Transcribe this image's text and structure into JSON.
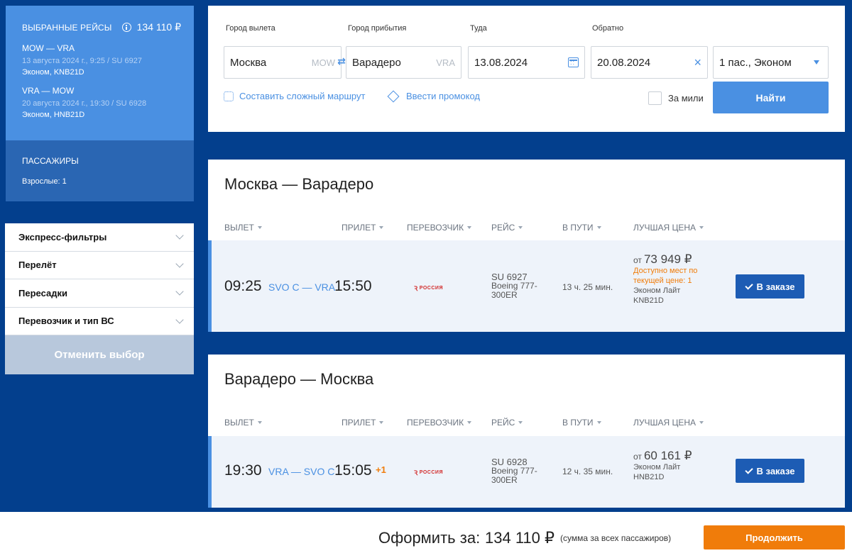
{
  "selected": {
    "title": "ВЫБРАННЫЕ РЕЙСЫ",
    "total": "134 110 ₽",
    "flights": [
      {
        "route": "MOW — VRA",
        "date": "13 августа 2024 г., 9:25 / SU 6927",
        "class": "Эконом, KNB21D"
      },
      {
        "route": "VRA — MOW",
        "date": "20 августа 2024 г., 19:30 / SU 6928",
        "class": "Эконом, HNB21D"
      }
    ]
  },
  "passengers": {
    "title": "ПАССАЖИРЫ",
    "adults": "Взрослые: 1"
  },
  "filters": {
    "items": [
      "Экспресс-фильтры",
      "Перелёт",
      "Пересадки",
      "Перевозчик и тип ВС"
    ],
    "reset": "Отменить выбор"
  },
  "search": {
    "from_label": "Город вылета",
    "from_value": "Москва",
    "from_code": "MOW",
    "to_label": "Город прибытия",
    "to_value": "Варадеро",
    "to_code": "VRA",
    "there_label": "Туда",
    "there_value": "13.08.2024",
    "back_label": "Обратно",
    "back_value": "20.08.2024",
    "pax_value": "1 пас., Эконом",
    "complex_route": "Составить сложный маршрут",
    "promo": "Ввести промокод",
    "miles": "За мили",
    "find": "Найти"
  },
  "columns": [
    "ВЫЛЕТ",
    "ПРИЛЕТ",
    "ПЕРЕВОЗЧИК",
    "РЕЙС",
    "В ПУТИ",
    "ЛУЧШАЯ ЦЕНА"
  ],
  "outbound": {
    "title": "Москва — Варадеро",
    "dep": "09:25",
    "airports": "SVO C — VRA",
    "arr": "15:50",
    "plus": "",
    "carrier": "РОССИЯ",
    "flight_no": "SU 6927",
    "aircraft": "Boeing 777-300ER",
    "duration": "13 ч. 25 мин.",
    "price_from": "от",
    "price": "73 949 ₽",
    "warn": "Доступно мест по текущей цене: 1",
    "fare": "Эконом Лайт",
    "fare_code": "KNB21D",
    "button": "В заказе"
  },
  "inbound": {
    "title": "Варадеро — Москва",
    "dep": "19:30",
    "airports": "VRA — SVO C",
    "arr": "15:05",
    "plus": "+1",
    "carrier": "РОССИЯ",
    "flight_no": "SU 6928",
    "aircraft": "Boeing 777-300ER",
    "duration": "12 ч. 35 мин.",
    "price_from": "от",
    "price": "60 161 ₽",
    "fare": "Эконом Лайт",
    "fare_code": "HNB21D",
    "button": "В заказе"
  },
  "checkout": {
    "label": "Оформить за:",
    "amount": "134 110 ₽",
    "note": "(сумма за всех пассажиров)",
    "continue": "Продолжить"
  }
}
